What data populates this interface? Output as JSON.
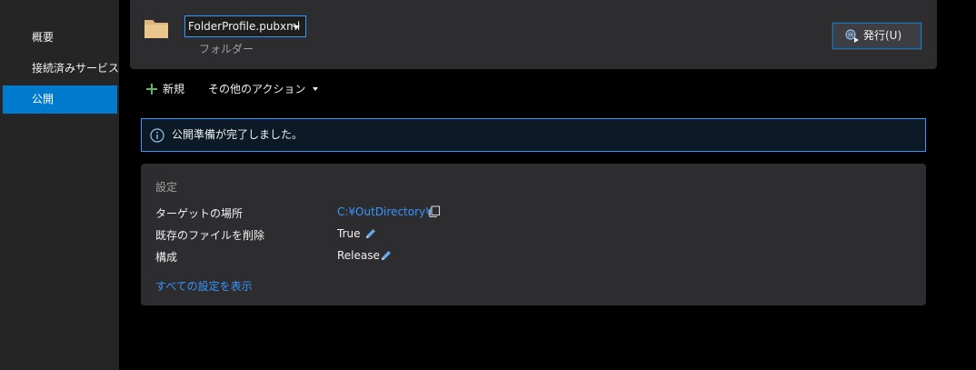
{
  "sidebar": {
    "items": [
      {
        "label": "概要",
        "active": false
      },
      {
        "label": "接続済みサービス",
        "active": false
      },
      {
        "label": "公開",
        "active": true
      }
    ]
  },
  "profile": {
    "name": "FolderProfile.pubxml",
    "type": "フォルダー",
    "publish_label": "発行(U)",
    "folder_icon": "folder-icon",
    "publish_icon": "publish-icon"
  },
  "toolbar": {
    "new_label": "新規",
    "more_actions_label": "その他のアクション"
  },
  "info": {
    "message": "公開準備が完了しました。",
    "icon": "info-icon"
  },
  "settings": {
    "title": "設定",
    "rows": [
      {
        "label": "ターゲットの場所",
        "value": "C:¥OutDirectory¥",
        "action_icon": "copy-icon"
      },
      {
        "label": "既存のファイルを削除",
        "value": "True",
        "action_icon": "edit-icon"
      },
      {
        "label": "構成",
        "value": "Release",
        "action_icon": "edit-icon"
      }
    ],
    "show_all_label": "すべての設定を表示"
  },
  "colors": {
    "accent": "#007acc",
    "link": "#3794ff",
    "folder": "#dcb67a",
    "plus": "#6ab36a",
    "edit": "#68a8e8"
  }
}
